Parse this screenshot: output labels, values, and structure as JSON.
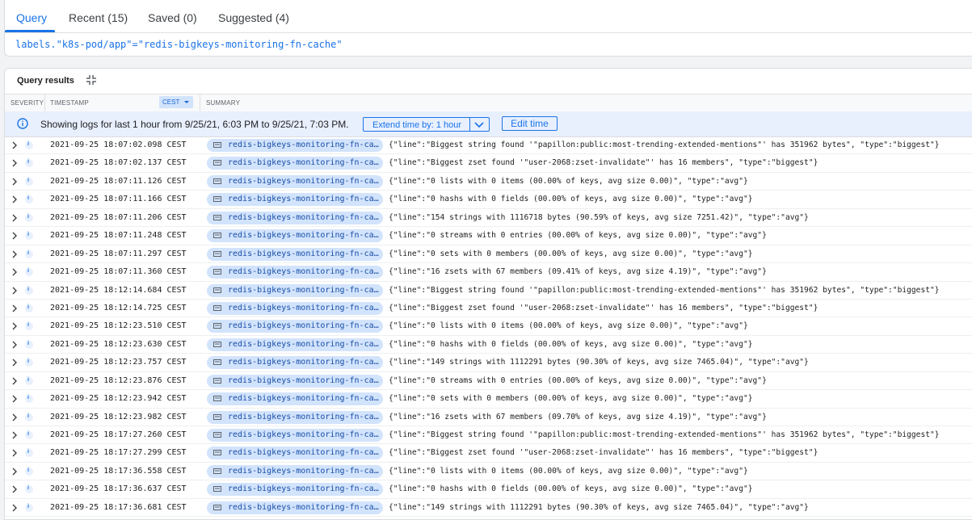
{
  "tabs": [
    {
      "label": "Query"
    },
    {
      "label": "Recent (15)"
    },
    {
      "label": "Saved (0)"
    },
    {
      "label": "Suggested (4)"
    }
  ],
  "query": {
    "text": "labels.\"k8s-pod/app\"=\"redis-bigkeys-monitoring-fn-cache\""
  },
  "results": {
    "title": "Query results",
    "columns": {
      "severity": "SEVERITY",
      "timestamp": "TIMESTAMP",
      "timezone": "CEST",
      "summary": "SUMMARY"
    },
    "banner": {
      "text": "Showing logs for last 1 hour from 9/25/21, 6:03 PM to 9/25/21, 7:03 PM.",
      "extend_label": "Extend time by: 1 hour",
      "edit_label": "Edit time"
    },
    "rows": [
      {
        "ts": "2021-09-25 18:07:02.098 CEST",
        "chip": "redis-bigkeys-monitoring-fn-ca…",
        "summary": "{\"line\":\"Biggest string found '\"papillon:public:most-trending-extended-mentions\"' has 351962 bytes\", \"type\":\"biggest\"}"
      },
      {
        "ts": "2021-09-25 18:07:02.137 CEST",
        "chip": "redis-bigkeys-monitoring-fn-ca…",
        "summary": "{\"line\":\"Biggest zset found '\"user-2068:zset-invalidate\"' has 16 members\", \"type\":\"biggest\"}"
      },
      {
        "ts": "2021-09-25 18:07:11.126 CEST",
        "chip": "redis-bigkeys-monitoring-fn-ca…",
        "summary": "{\"line\":\"0 lists with 0 items (00.00% of keys, avg size 0.00)\", \"type\":\"avg\"}"
      },
      {
        "ts": "2021-09-25 18:07:11.166 CEST",
        "chip": "redis-bigkeys-monitoring-fn-ca…",
        "summary": "{\"line\":\"0 hashs with 0 fields (00.00% of keys, avg size 0.00)\", \"type\":\"avg\"}"
      },
      {
        "ts": "2021-09-25 18:07:11.206 CEST",
        "chip": "redis-bigkeys-monitoring-fn-ca…",
        "summary": "{\"line\":\"154 strings with 1116718 bytes (90.59% of keys, avg size 7251.42)\", \"type\":\"avg\"}"
      },
      {
        "ts": "2021-09-25 18:07:11.248 CEST",
        "chip": "redis-bigkeys-monitoring-fn-ca…",
        "summary": "{\"line\":\"0 streams with 0 entries (00.00% of keys, avg size 0.00)\", \"type\":\"avg\"}"
      },
      {
        "ts": "2021-09-25 18:07:11.297 CEST",
        "chip": "redis-bigkeys-monitoring-fn-ca…",
        "summary": "{\"line\":\"0 sets with 0 members (00.00% of keys, avg size 0.00)\", \"type\":\"avg\"}"
      },
      {
        "ts": "2021-09-25 18:07:11.360 CEST",
        "chip": "redis-bigkeys-monitoring-fn-ca…",
        "summary": "{\"line\":\"16 zsets with 67 members (09.41% of keys, avg size 4.19)\", \"type\":\"avg\"}"
      },
      {
        "ts": "2021-09-25 18:12:14.684 CEST",
        "chip": "redis-bigkeys-monitoring-fn-ca…",
        "summary": "{\"line\":\"Biggest string found '\"papillon:public:most-trending-extended-mentions\"' has 351962 bytes\", \"type\":\"biggest\"}"
      },
      {
        "ts": "2021-09-25 18:12:14.725 CEST",
        "chip": "redis-bigkeys-monitoring-fn-ca…",
        "summary": "{\"line\":\"Biggest zset found '\"user-2068:zset-invalidate\"' has 16 members\", \"type\":\"biggest\"}"
      },
      {
        "ts": "2021-09-25 18:12:23.510 CEST",
        "chip": "redis-bigkeys-monitoring-fn-ca…",
        "summary": "{\"line\":\"0 lists with 0 items (00.00% of keys, avg size 0.00)\", \"type\":\"avg\"}"
      },
      {
        "ts": "2021-09-25 18:12:23.630 CEST",
        "chip": "redis-bigkeys-monitoring-fn-ca…",
        "summary": "{\"line\":\"0 hashs with 0 fields (00.00% of keys, avg size 0.00)\", \"type\":\"avg\"}"
      },
      {
        "ts": "2021-09-25 18:12:23.757 CEST",
        "chip": "redis-bigkeys-monitoring-fn-ca…",
        "summary": "{\"line\":\"149 strings with 1112291 bytes (90.30% of keys, avg size 7465.04)\", \"type\":\"avg\"}"
      },
      {
        "ts": "2021-09-25 18:12:23.876 CEST",
        "chip": "redis-bigkeys-monitoring-fn-ca…",
        "summary": "{\"line\":\"0 streams with 0 entries (00.00% of keys, avg size 0.00)\", \"type\":\"avg\"}"
      },
      {
        "ts": "2021-09-25 18:12:23.942 CEST",
        "chip": "redis-bigkeys-monitoring-fn-ca…",
        "summary": "{\"line\":\"0 sets with 0 members (00.00% of keys, avg size 0.00)\", \"type\":\"avg\"}"
      },
      {
        "ts": "2021-09-25 18:12:23.982 CEST",
        "chip": "redis-bigkeys-monitoring-fn-ca…",
        "summary": "{\"line\":\"16 zsets with 67 members (09.70% of keys, avg size 4.19)\", \"type\":\"avg\"}"
      },
      {
        "ts": "2021-09-25 18:17:27.260 CEST",
        "chip": "redis-bigkeys-monitoring-fn-ca…",
        "summary": "{\"line\":\"Biggest string found '\"papillon:public:most-trending-extended-mentions\"' has 351962 bytes\", \"type\":\"biggest\"}"
      },
      {
        "ts": "2021-09-25 18:17:27.299 CEST",
        "chip": "redis-bigkeys-monitoring-fn-ca…",
        "summary": "{\"line\":\"Biggest zset found '\"user-2068:zset-invalidate\"' has 16 members\", \"type\":\"biggest\"}"
      },
      {
        "ts": "2021-09-25 18:17:36.558 CEST",
        "chip": "redis-bigkeys-monitoring-fn-ca…",
        "summary": "{\"line\":\"0 lists with 0 items (00.00% of keys, avg size 0.00)\", \"type\":\"avg\"}"
      },
      {
        "ts": "2021-09-25 18:17:36.637 CEST",
        "chip": "redis-bigkeys-monitoring-fn-ca…",
        "summary": "{\"line\":\"0 hashs with 0 fields (00.00% of keys, avg size 0.00)\", \"type\":\"avg\"}"
      },
      {
        "ts": "2021-09-25 18:17:36.681 CEST",
        "chip": "redis-bigkeys-monitoring-fn-ca…",
        "summary": "{\"line\":\"149 strings with 1112291 bytes (90.30% of keys, avg size 7465.04)\", \"type\":\"avg\"}"
      }
    ]
  },
  "colors": {
    "accent": "#1a73e8",
    "chip_bg": "#d2e3fc",
    "banner_bg": "#e8f0fe"
  },
  "icons": {
    "collapse": "collapse-icon",
    "info": "info-icon",
    "expand": "chevron-right-icon",
    "severity": "info-severity-icon",
    "pod": "pod-icon"
  }
}
